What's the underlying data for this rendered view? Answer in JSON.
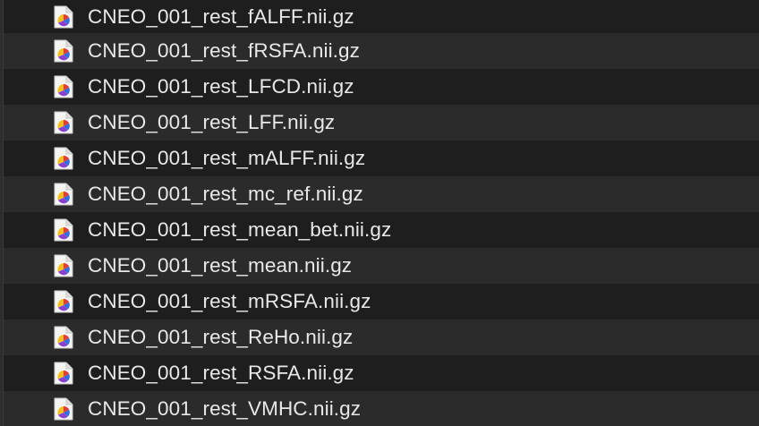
{
  "files": [
    {
      "name": "CNEO_001_rest_fALFF.nii.gz",
      "icon": "nifti-document-icon"
    },
    {
      "name": "CNEO_001_rest_fRSFA.nii.gz",
      "icon": "nifti-document-icon"
    },
    {
      "name": "CNEO_001_rest_LFCD.nii.gz",
      "icon": "nifti-document-icon"
    },
    {
      "name": "CNEO_001_rest_LFF.nii.gz",
      "icon": "nifti-document-icon"
    },
    {
      "name": "CNEO_001_rest_mALFF.nii.gz",
      "icon": "nifti-document-icon"
    },
    {
      "name": "CNEO_001_rest_mc_ref.nii.gz",
      "icon": "nifti-document-icon"
    },
    {
      "name": "CNEO_001_rest_mean_bet.nii.gz",
      "icon": "nifti-document-icon"
    },
    {
      "name": "CNEO_001_rest_mean.nii.gz",
      "icon": "nifti-document-icon"
    },
    {
      "name": "CNEO_001_rest_mRSFA.nii.gz",
      "icon": "nifti-document-icon"
    },
    {
      "name": "CNEO_001_rest_ReHo.nii.gz",
      "icon": "nifti-document-icon"
    },
    {
      "name": "CNEO_001_rest_RSFA.nii.gz",
      "icon": "nifti-document-icon"
    },
    {
      "name": "CNEO_001_rest_VMHC.nii.gz",
      "icon": "nifti-document-icon"
    }
  ]
}
